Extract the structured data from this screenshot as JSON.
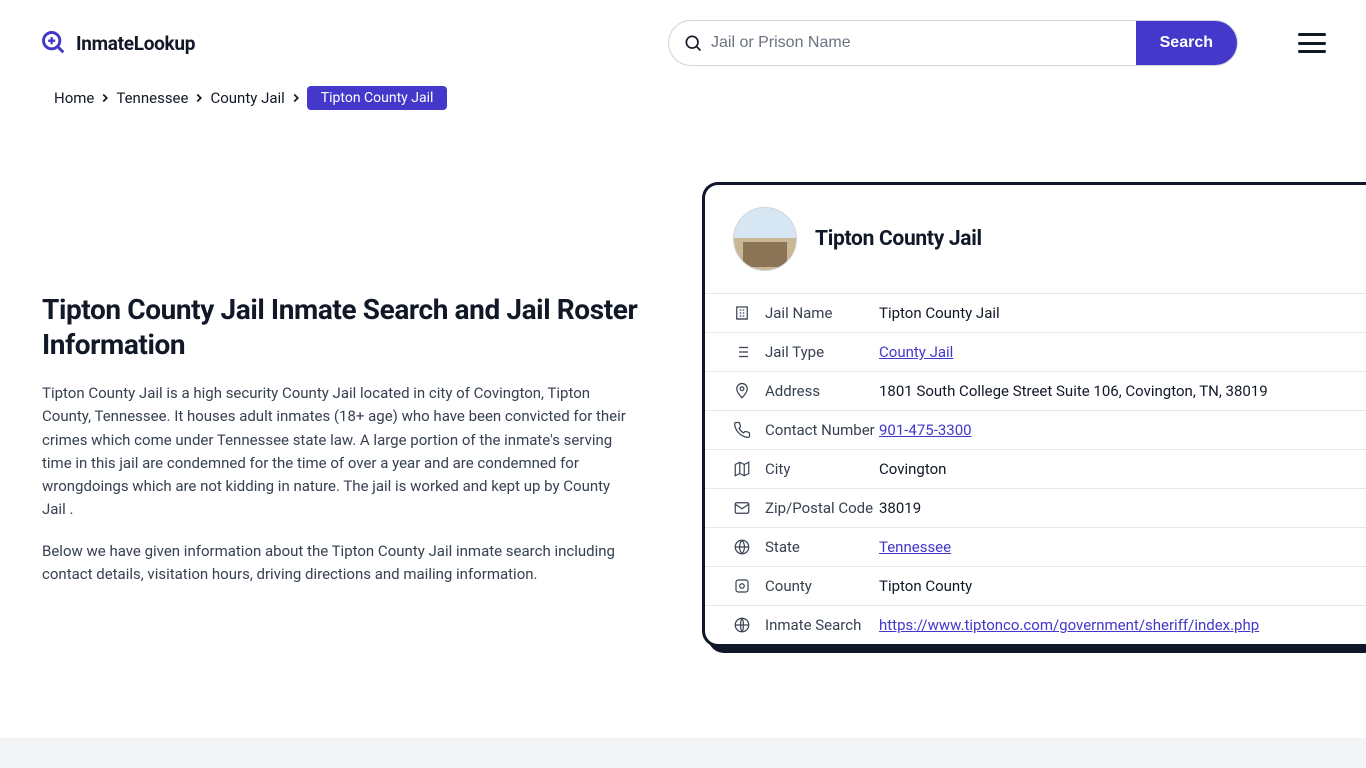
{
  "brand": "InmateLookup",
  "search": {
    "placeholder": "Jail or Prison Name",
    "button": "Search"
  },
  "breadcrumb": {
    "items": [
      "Home",
      "Tennessee",
      "County Jail"
    ],
    "current": "Tipton County Jail"
  },
  "content": {
    "title": "Tipton County Jail Inmate Search and Jail Roster Information",
    "para1": "Tipton County Jail is a high security County Jail located in city of Covington, Tipton County, Tennessee. It houses adult inmates (18+ age) who have been convicted for their crimes which come under Tennessee state law. A large portion of the inmate's serving time in this jail are condemned for the time of over a year and are condemned for wrongdoings which are not kidding in nature. The jail is worked and kept up by County Jail .",
    "para2": "Below we have given information about the Tipton County Jail inmate search including contact details, visitation hours, driving directions and mailing information."
  },
  "card": {
    "title": "Tipton County Jail",
    "rows": [
      {
        "icon": "building",
        "label": "Jail Name",
        "value": "Tipton County Jail",
        "link": false
      },
      {
        "icon": "list",
        "label": "Jail Type",
        "value": "County Jail",
        "link": true
      },
      {
        "icon": "pin",
        "label": "Address",
        "value": "1801 South College Street Suite 106, Covington, TN, 38019",
        "link": false
      },
      {
        "icon": "phone",
        "label": "Contact Number",
        "value": "901-475-3300",
        "link": true
      },
      {
        "icon": "map",
        "label": "City",
        "value": "Covington",
        "link": false
      },
      {
        "icon": "envelope",
        "label": "Zip/Postal Code",
        "value": "38019",
        "link": false
      },
      {
        "icon": "globe",
        "label": "State",
        "value": "Tennessee",
        "link": true
      },
      {
        "icon": "badge",
        "label": "County",
        "value": "Tipton County",
        "link": false
      },
      {
        "icon": "web",
        "label": "Inmate Search",
        "value": "https://www.tiptonco.com/government/sheriff/index.php",
        "link": true
      }
    ]
  }
}
